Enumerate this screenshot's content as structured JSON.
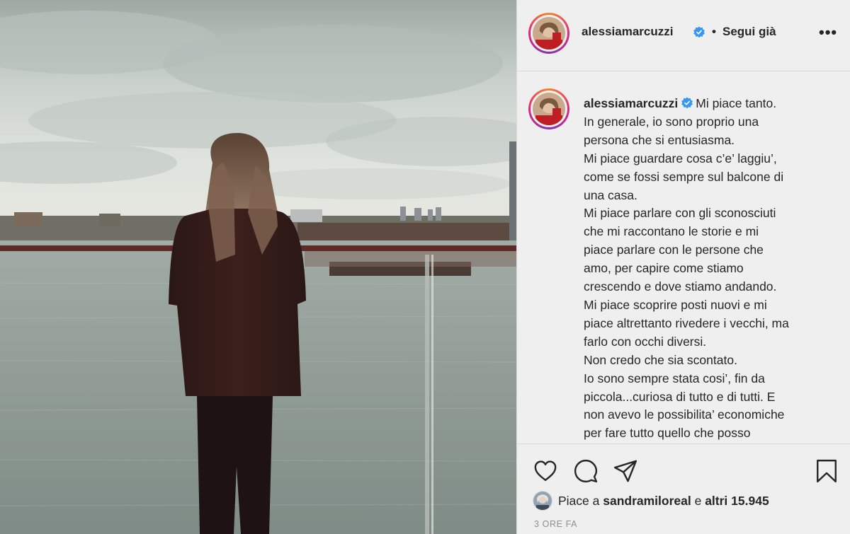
{
  "post": {
    "username": "alessiamarcuzzi",
    "follow_separator": "•",
    "follow_label": "Segui già",
    "more_label": "•••",
    "caption_username": "alessiamarcuzzi",
    "caption_lines": [
      "Mi piace tanto.",
      "In generale, io sono proprio una",
      "persona che si entusiasma.",
      "Mi piace guardare cosa c’e’ laggiu’,",
      "come se fossi sempre sul balcone di",
      "una casa.",
      "Mi piace parlare con gli sconosciuti",
      "che mi raccontano le storie e mi",
      "piace parlare con le persone che",
      "amo, per capire come stiamo",
      "crescendo e dove stiamo andando.",
      "Mi piace scoprire posti nuovi e mi",
      "piace altrettanto rivedere i vecchi, ma",
      "farlo con occhi diversi.",
      "Non credo che sia scontato.",
      "Io sono sempre stata cosi’, fin da",
      "piccola...curiosa di tutto e di tutti. E",
      "non avevo le possibilita’ economiche",
      "per fare tutto quello che posso"
    ],
    "likes_prefix": "Piace a ",
    "likes_user": "sandramiloreal",
    "likes_middle": " e ",
    "likes_count": "altri 15.945",
    "timestamp": "3 ORE FA"
  },
  "icons": {
    "verified": "verified-badge-icon",
    "like": "heart-icon",
    "comment": "comment-icon",
    "share": "paper-plane-icon",
    "save": "bookmark-icon",
    "more": "more-options-icon"
  },
  "colors": {
    "verified_blue": "#3897f0",
    "text": "#262626",
    "muted": "#8e8e8e",
    "panel_bg": "#efefef",
    "border": "#dbdbdb"
  }
}
